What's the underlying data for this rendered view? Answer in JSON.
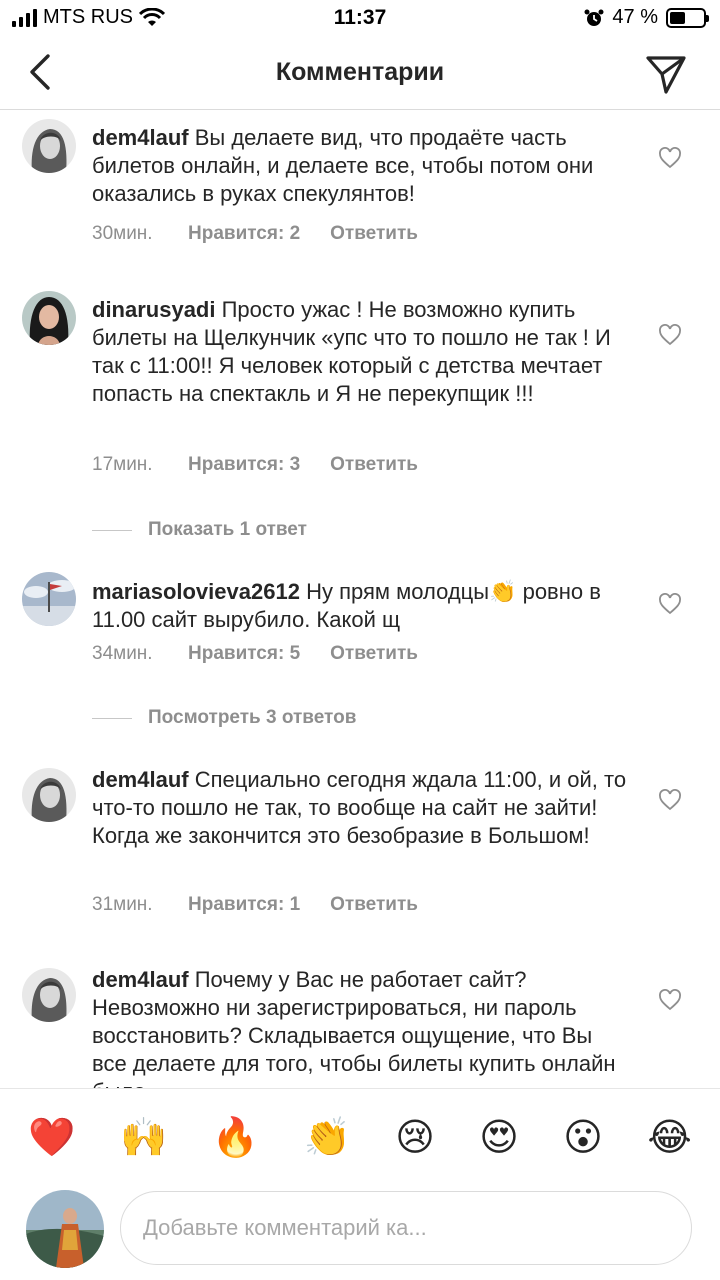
{
  "status_bar": {
    "carrier": "MTS RUS",
    "time": "11:37",
    "battery": "47 %",
    "battery_level": 0.47
  },
  "header": {
    "title": "Комментарии",
    "back_icon": "chevron-left-icon",
    "send_icon": "paper-plane-icon"
  },
  "comments": [
    {
      "username": "dem4lauf",
      "text": "Вы делаете вид, что продаёте часть билетов онлайн, и делаете все, чтобы потом они оказались в руках спекулянтов!",
      "time": "30мин.",
      "likes": "Нравится: 2",
      "reply": "Ответить"
    },
    {
      "username": "dinarusyadi",
      "text": "Просто ужас ! Не возможно купить билеты на Щелкунчик «упс что то пошло не так ! И так с 11:00!! Я человек который с детства мечтает попасть на спектакль и Я не перекупщик !!!",
      "time": "17мин.",
      "likes": "Нравится: 3",
      "reply": "Ответить",
      "replies_toggle": "Показать 1 ответ"
    },
    {
      "username": "mariasolovieva2612",
      "text": "Ну прям молодцы👏 ровно в 11.00 сайт вырубило. Какой щ",
      "time": "34мин.",
      "likes": "Нравится: 5",
      "reply": "Ответить",
      "replies_toggle": "Посмотреть 3 ответов"
    },
    {
      "username": "dem4lauf",
      "text": "Специально сегодня ждала 11:00, и ой, то что-то пошло не так, то вообще на сайт не зайти! Когда же закончится это безобразие в Большом!",
      "time": "31мин.",
      "likes": "Нравится: 1",
      "reply": "Ответить"
    },
    {
      "username": "dem4lauf",
      "text": "Почему у Вас не работает сайт? Невозможно ни зарегистрироваться, ни пароль восстановить? Складывается ощущение, что Вы все делаете для того, чтобы билеты купить онлайн было",
      "time": "",
      "likes": "",
      "reply": ""
    }
  ],
  "emoji_bar": [
    "❤️",
    "🙌",
    "🔥",
    "👏",
    "😢",
    "😍",
    "😮",
    "😂"
  ],
  "input": {
    "placeholder": "Добавьте комментарий ка..."
  },
  "colors": {
    "text": "#262626",
    "meta": "#8e8e8e",
    "divider": "#dbdbdb"
  }
}
